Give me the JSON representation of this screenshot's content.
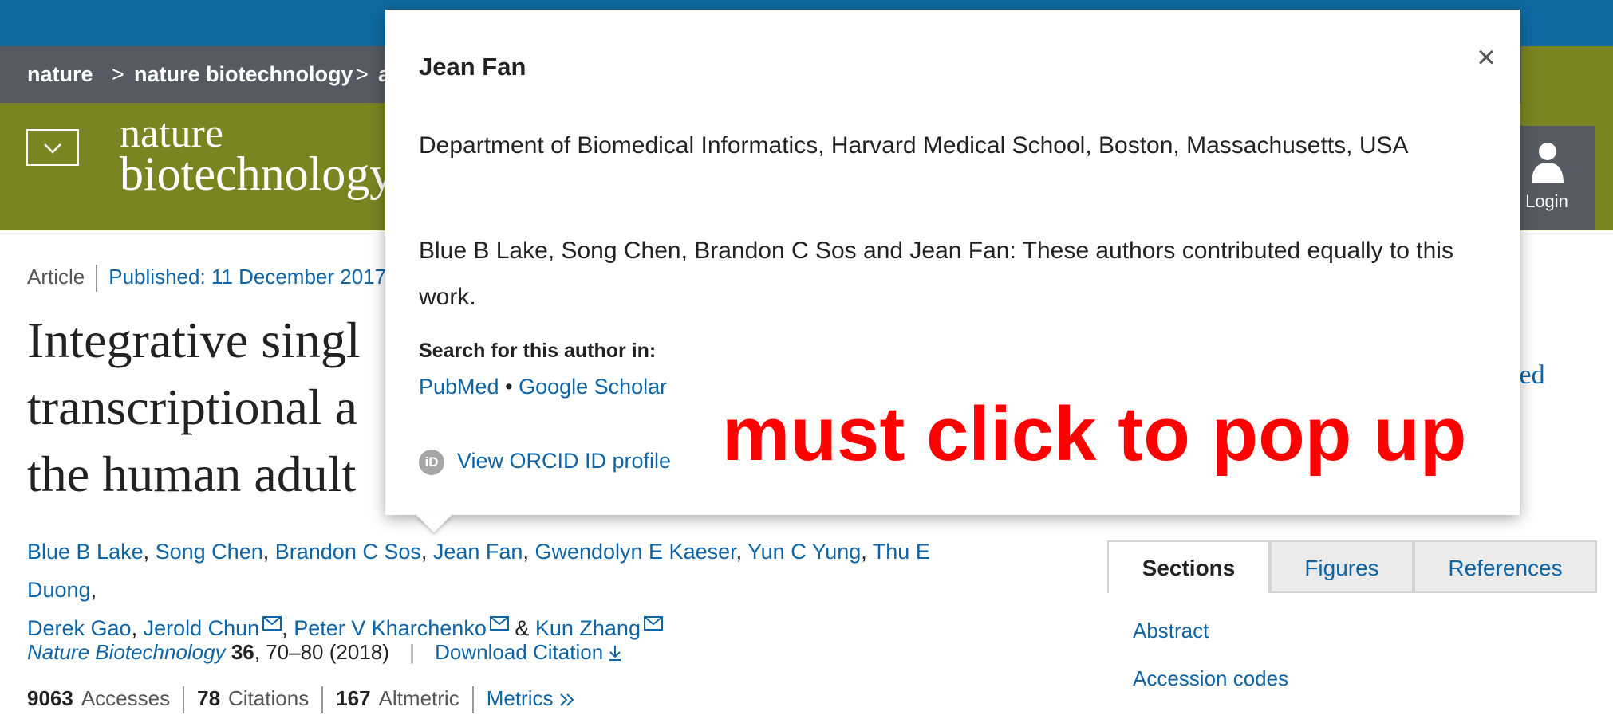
{
  "breadcrumb": {
    "items": [
      "nature",
      "nature biotechnology",
      "a"
    ],
    "separator": ">"
  },
  "brand": {
    "line1": "nature",
    "line2": "biotechnology",
    "menu_icon": "chevron-down-icon",
    "login_label": "Login",
    "login_icon": "person-icon"
  },
  "article": {
    "type": "Article",
    "published": "Published: 11 December 2017",
    "title_lines": [
      "Integrative singl",
      "transcriptional a",
      "the human adult"
    ],
    "related_partial": "ated",
    "authors": [
      "Blue B Lake",
      "Song Chen",
      "Brandon C Sos",
      "Jean Fan",
      "Gwendolyn E Kaeser",
      "Yun C Yung",
      "Thu E Duong",
      "Derek Gao",
      "Jerold Chun",
      "Peter V Kharchenko",
      "Kun Zhang"
    ],
    "citation": {
      "journal": "Nature Biotechnology",
      "volume": "36",
      "pages": ", 70–80 (2018)",
      "download": "Download Citation"
    },
    "metrics": {
      "accesses_value": "9063",
      "accesses_label": "Accesses",
      "citations_value": "78",
      "citations_label": "Citations",
      "altmetric_value": "167",
      "altmetric_label": "Altmetric",
      "metrics_link": "Metrics"
    }
  },
  "sidebar": {
    "tabs": [
      "Sections",
      "Figures",
      "References"
    ],
    "active_tab": "Sections",
    "section_links": [
      "Abstract",
      "Accession codes"
    ]
  },
  "popover": {
    "name": "Jean Fan",
    "affiliation": "Department of Biomedical Informatics, Harvard Medical School, Boston, Massachusetts, USA",
    "note": "Blue B Lake, Song Chen, Brandon C Sos and Jean Fan: These authors contributed equally to this work.",
    "search_label": "Search for this author in:",
    "search_links": [
      "PubMed",
      "Google Scholar"
    ],
    "link_separator": "•",
    "orcid_label": "View ORCID ID profile",
    "orcid_badge": "iD",
    "close_symbol": "×"
  },
  "annotation": {
    "text": "must click to pop up",
    "color": "#ff0000"
  },
  "colors": {
    "brand_blue": "#0f6aa0",
    "crumb_gray": "#555a63",
    "brand_olive": "#7a8421",
    "link": "#0d64a6"
  }
}
